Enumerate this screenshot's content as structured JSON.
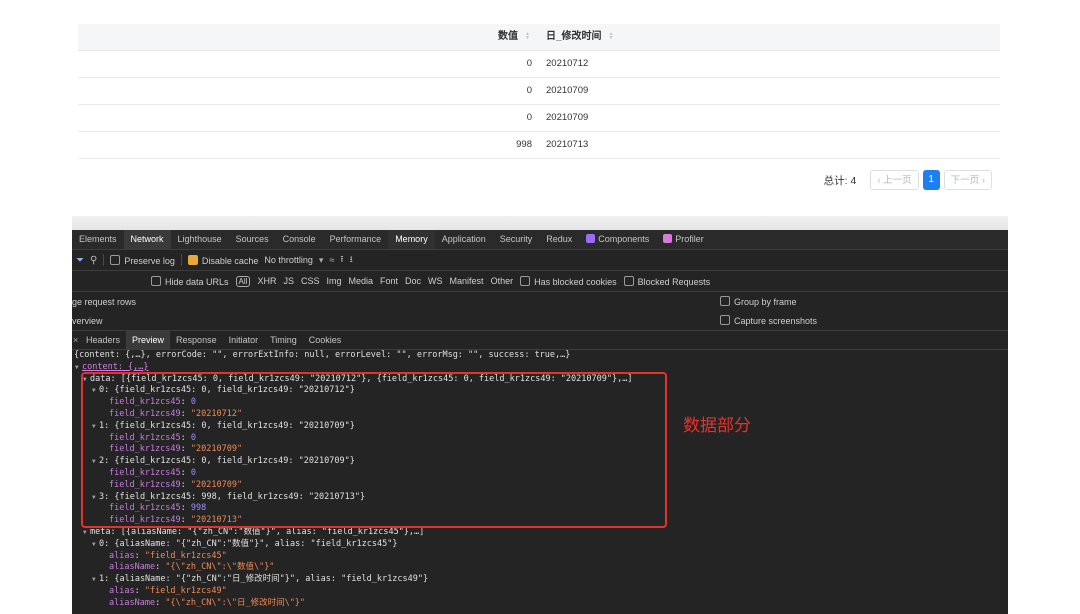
{
  "table": {
    "headers": [
      "数值",
      "日_修改时间"
    ],
    "rows": [
      [
        "0",
        "20210712"
      ],
      [
        "0",
        "20210709"
      ],
      [
        "0",
        "20210709"
      ],
      [
        "998",
        "20210713"
      ]
    ],
    "total_label": "总计: 4",
    "prev_label": "上一页",
    "page": "1",
    "next_label": "下一页"
  },
  "devtools": {
    "tabs": [
      "Elements",
      "Network",
      "Lighthouse",
      "Sources",
      "Console",
      "Performance",
      "Memory",
      "Application",
      "Security",
      "Redux",
      "Components",
      "Profiler"
    ],
    "toolbar": {
      "preserve_log": "Preserve log",
      "disable_cache": "Disable cache",
      "throttle": "No throttling"
    },
    "filter": {
      "hide_data_urls": "Hide data URLs",
      "all": "All",
      "types": [
        "XHR",
        "JS",
        "CSS",
        "Img",
        "Media",
        "Font",
        "Doc",
        "WS",
        "Manifest",
        "Other"
      ],
      "has_blocked": "Has blocked cookies",
      "blocked_requests": "Blocked Requests"
    },
    "options": {
      "large_rows": "ge request rows",
      "overview": "verview",
      "group_by_frame": "Group by frame",
      "capture": "Capture screenshots"
    },
    "subtabs": [
      "Headers",
      "Preview",
      "Response",
      "Initiator",
      "Timing",
      "Cookies"
    ],
    "code": {
      "l0": "{content: {,…}, errorCode: \"\", errorExtInfo: null, errorLevel: \"\", errorMsg: \"\", success: true,…}",
      "l1": "content: {,…}",
      "l2": "data: [{field_kr1zcs45: 0, field_kr1zcs49: \"20210712\"}, {field_kr1zcs45: 0, field_kr1zcs49: \"20210709\"},…]",
      "items": [
        {
          "head": "0: {field_kr1zcs45: 0, field_kr1zcs49: \"20210712\"}",
          "k1": "field_kr1zcs45",
          "v1": "0",
          "k2": "field_kr1zcs49",
          "v2": "\"20210712\""
        },
        {
          "head": "1: {field_kr1zcs45: 0, field_kr1zcs49: \"20210709\"}",
          "k1": "field_kr1zcs45",
          "v1": "0",
          "k2": "field_kr1zcs49",
          "v2": "\"20210709\""
        },
        {
          "head": "2: {field_kr1zcs45: 0, field_kr1zcs49: \"20210709\"}",
          "k1": "field_kr1zcs45",
          "v1": "0",
          "k2": "field_kr1zcs49",
          "v2": "\"20210709\""
        },
        {
          "head": "3: {field_kr1zcs45: 998, field_kr1zcs49: \"20210713\"}",
          "k1": "field_kr1zcs45",
          "v1": "998",
          "k2": "field_kr1zcs49",
          "v2": "\"20210713\""
        }
      ],
      "meta": "meta: [{aliasName: \"{\"zh_CN\":\"数值\"}\", alias: \"field_kr1zcs45\"},…]",
      "m0": "0: {aliasName: \"{\"zh_CN\":\"数值\"}\", alias: \"field_kr1zcs45\"}",
      "m0_alias_k": "alias",
      "m0_alias_v": "\"field_kr1zcs45\"",
      "m0_aliasname_k": "aliasName",
      "m0_aliasname_v": "\"{\\\"zh_CN\\\":\\\"数值\\\"}\"",
      "m1": "1: {aliasName: \"{\"zh_CN\":\"日_修改时间\"}\", alias: \"field_kr1zcs49\"}",
      "m1_alias_k": "alias",
      "m1_alias_v": "\"field_kr1zcs49\"",
      "m1_aliasname_k": "aliasName",
      "m1_aliasname_v": "\"{\\\"zh_CN\\\":\\\"日_修改时间\\\"}\""
    }
  },
  "annotation": "数据部分",
  "colors": {
    "accent": "#1e7ff0",
    "highlight_box": "#e5322d"
  }
}
